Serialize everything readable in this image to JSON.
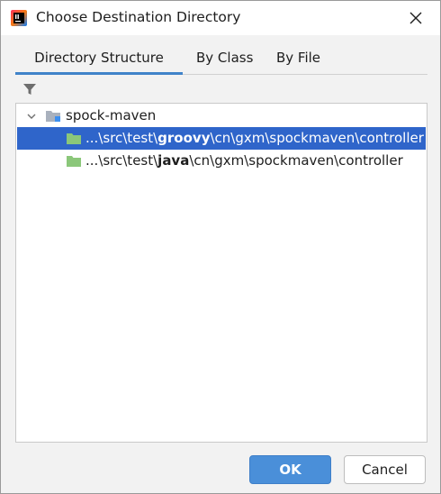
{
  "window": {
    "title": "Choose Destination Directory",
    "app_icon": "intellij-idea-icon",
    "close_icon": "close-icon"
  },
  "tabs": [
    {
      "label": "Directory Structure",
      "active": true
    },
    {
      "label": "By Class",
      "active": false
    },
    {
      "label": "By File",
      "active": false
    }
  ],
  "toolbar": {
    "filter_icon": "filter-icon"
  },
  "tree": {
    "root": {
      "label": "spock-maven",
      "expanded": true,
      "icon": "module-folder-icon"
    },
    "items": [
      {
        "prefix": "...\\src\\test\\",
        "bold": "groovy",
        "suffix": "\\cn\\gxm\\spockmaven\\controller",
        "selected": true,
        "icon": "test-folder-icon"
      },
      {
        "prefix": "...\\src\\test\\",
        "bold": "java",
        "suffix": "\\cn\\gxm\\spockmaven\\controller",
        "selected": false,
        "icon": "test-folder-icon"
      }
    ]
  },
  "buttons": {
    "ok": "OK",
    "cancel": "Cancel"
  },
  "colors": {
    "accent": "#4083c9",
    "selection": "#2f65ca",
    "ok_button": "#4a8fd9",
    "folder_green": "#8bc77a"
  }
}
